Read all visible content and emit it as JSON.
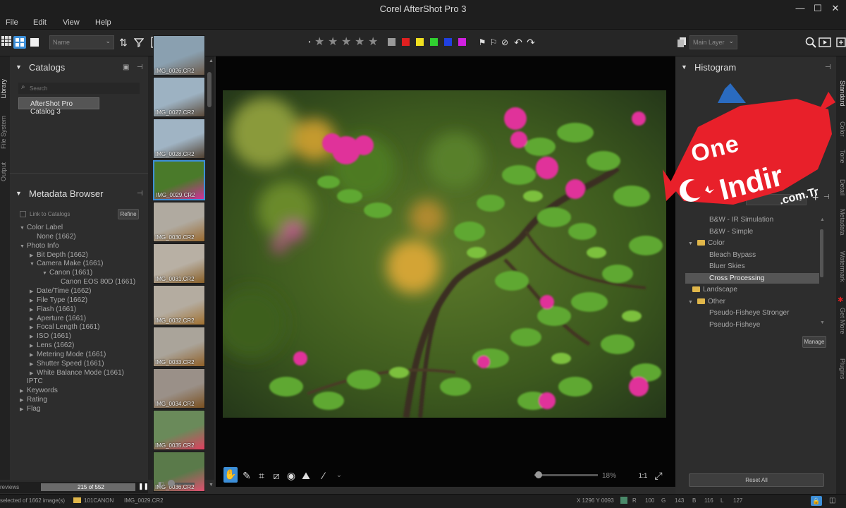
{
  "window": {
    "title": "Corel AfterShot Pro 3",
    "minimize": "—",
    "maximize": "☐",
    "close": "✕"
  },
  "menu": [
    "File",
    "Edit",
    "View",
    "Help"
  ],
  "toolbar": {
    "sort_dropdown": "Name",
    "layer_dropdown": "Main Layer",
    "stars": [
      "★",
      "★",
      "★",
      "★",
      "★"
    ],
    "color_labels": [
      "#9a9a9a",
      "#e02020",
      "#f0e020",
      "#30d030",
      "#2040e0",
      "#d020e0"
    ]
  },
  "left_tabs": [
    "Library",
    "File System",
    "Output"
  ],
  "catalogs": {
    "title": "Catalogs",
    "search_placeholder": "Search",
    "items": [
      "AfterShot Pro Catalog 3"
    ]
  },
  "metadata_browser": {
    "title": "Metadata Browser",
    "link_label": "Link to Catalogs",
    "refine_button": "Refine",
    "tree": [
      {
        "label": "Color Label",
        "level": 0,
        "toggle": "▼"
      },
      {
        "label": "None (1662)",
        "level": 1,
        "toggle": ""
      },
      {
        "label": "Photo Info",
        "level": 0,
        "toggle": "▼"
      },
      {
        "label": "Bit Depth (1662)",
        "level": 1,
        "toggle": "▶"
      },
      {
        "label": "Camera Make (1661)",
        "level": 1,
        "toggle": "▼"
      },
      {
        "label": "Canon (1661)",
        "level": 2,
        "toggle": "▼"
      },
      {
        "label": "Canon EOS 80D (1661)",
        "level": 3,
        "toggle": ""
      },
      {
        "label": "Date/Time (1662)",
        "level": 1,
        "toggle": "▶"
      },
      {
        "label": "File Type (1662)",
        "level": 1,
        "toggle": "▶"
      },
      {
        "label": "Flash (1661)",
        "level": 1,
        "toggle": "▶"
      },
      {
        "label": "Aperture (1661)",
        "level": 1,
        "toggle": "▶"
      },
      {
        "label": "Focal Length (1661)",
        "level": 1,
        "toggle": "▶"
      },
      {
        "label": "ISO (1661)",
        "level": 1,
        "toggle": "▶"
      },
      {
        "label": "Lens (1662)",
        "level": 1,
        "toggle": "▶"
      },
      {
        "label": "Metering Mode (1661)",
        "level": 1,
        "toggle": "▶"
      },
      {
        "label": "Shutter Speed (1661)",
        "level": 1,
        "toggle": "▶"
      },
      {
        "label": "White Balance Mode (1661)",
        "level": 1,
        "toggle": "▶"
      },
      {
        "label": "IPTC",
        "level": 0,
        "toggle": ""
      },
      {
        "label": "Keywords",
        "level": 0,
        "toggle": "▶"
      },
      {
        "label": "Rating",
        "level": 0,
        "toggle": "▶"
      },
      {
        "label": "Flag",
        "level": 0,
        "toggle": "▶"
      }
    ]
  },
  "filmstrip": {
    "thumbs": [
      {
        "name": "IMG_0026.CR2",
        "selected": false
      },
      {
        "name": "IMG_0027.CR2",
        "selected": false
      },
      {
        "name": "IMG_0028.CR2",
        "selected": false
      },
      {
        "name": "IMG_0029.CR2",
        "selected": true
      },
      {
        "name": "IMG_0030.CR2",
        "selected": false
      },
      {
        "name": "IMG_0031.CR2",
        "selected": false
      },
      {
        "name": "IMG_0032.CR2",
        "selected": false
      },
      {
        "name": "IMG_0033.CR2",
        "selected": false
      },
      {
        "name": "IMG_0034.CR2",
        "selected": false
      },
      {
        "name": "IMG_0035.CR2",
        "selected": false
      },
      {
        "name": "IMG_0036.CR2",
        "selected": false
      }
    ],
    "previews_label": "reviews",
    "counter": "215 of 552"
  },
  "viewer": {
    "zoom": "18%"
  },
  "histogram": {
    "title": "Histogram"
  },
  "presets": {
    "items": [
      {
        "label": "B&W - IR Simulation",
        "type": "preset",
        "selected": false
      },
      {
        "label": "B&W - Simple",
        "type": "preset",
        "selected": false
      },
      {
        "label": "Color",
        "type": "folder",
        "selected": false
      },
      {
        "label": "Bleach Bypass",
        "type": "preset",
        "selected": false
      },
      {
        "label": "Bluer Skies",
        "type": "preset",
        "selected": false
      },
      {
        "label": "Cross Processing",
        "type": "preset",
        "selected": true
      },
      {
        "label": "Landscape",
        "type": "folder",
        "selected": false
      },
      {
        "label": "Other",
        "type": "folder",
        "selected": false
      },
      {
        "label": "Pseudo-Fisheye Stronger",
        "type": "preset",
        "selected": false
      },
      {
        "label": "Pseudo-Fisheye",
        "type": "preset",
        "selected": false
      }
    ],
    "manage_button": "Manage",
    "reset_button": "Reset All"
  },
  "right_tabs": [
    "Standard",
    "Color",
    "Tone",
    "Detail",
    "Metadata",
    "Watermark",
    "Get More",
    "Plugins"
  ],
  "watermark": {
    "line1": "One",
    "line2": "Indir",
    "line3": ".com.Tr"
  },
  "status": {
    "selection": "selected of 1662 image(s)",
    "folder": "101CANON",
    "file": "IMG_0029.CR2",
    "coords": "X 1296  Y 0093",
    "r_label": "R",
    "r_val": "100",
    "g_label": "G",
    "g_val": "143",
    "b_label": "B",
    "b_val": "116",
    "l_label": "L",
    "l_val": "127"
  }
}
